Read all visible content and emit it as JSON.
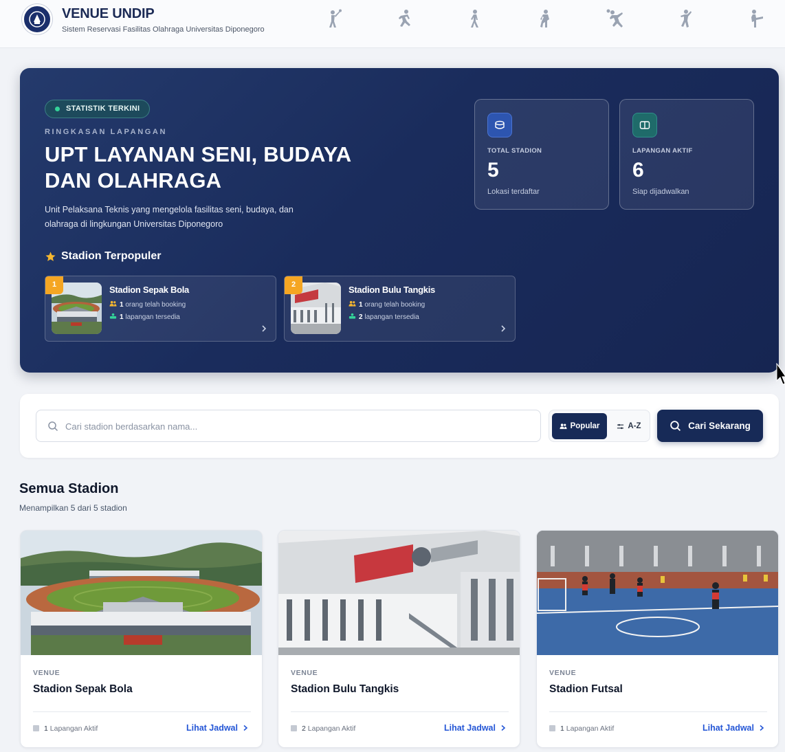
{
  "header": {
    "title": "VENUE UNDIP",
    "subtitle": "Sistem Reservasi Fasilitas Olahraga Universitas Diponegoro",
    "sport_icons": [
      "badminton-player-icon",
      "runner-icon",
      "walker-icon",
      "swimmer-icon",
      "basketball-player-icon",
      "dancer-icon",
      "kick-icon"
    ]
  },
  "hero": {
    "badge": "STATISTIK TERKINI",
    "kicker": "RINGKASAN LAPANGAN",
    "title": "UPT LAYANAN SENI, BUDAYA DAN OLAHRAGA",
    "description": "Unit Pelaksana Teknis yang mengelola fasilitas seni, budaya, dan olahraga di lingkungan Universitas Diponegoro",
    "popular_title": "Stadion Terpopuler",
    "popular": [
      {
        "rank": "1",
        "name": "Stadion Sepak Bola",
        "bookings_count": "1",
        "bookings_text": "orang telah booking",
        "courts_count": "1",
        "courts_text": "lapangan tersedia"
      },
      {
        "rank": "2",
        "name": "Stadion Bulu Tangkis",
        "bookings_count": "1",
        "bookings_text": "orang telah booking",
        "courts_count": "2",
        "courts_text": "lapangan tersedia"
      }
    ],
    "stats": [
      {
        "label": "TOTAL STADION",
        "value": "5",
        "sub": "Lokasi terdaftar",
        "icon": "database-icon"
      },
      {
        "label": "LAPANGAN AKTIF",
        "value": "6",
        "sub": "Siap dijadwalkan",
        "icon": "court-icon"
      }
    ]
  },
  "search": {
    "placeholder": "Cari stadion berdasarkan nama...",
    "value": "",
    "sort_popular": "Popular",
    "sort_az": "A-Z",
    "button": "Cari Sekarang"
  },
  "stadiums": {
    "title": "Semua Stadion",
    "subtitle": "Menampilkan 5 dari 5 stadion",
    "items": [
      {
        "kicker": "VENUE",
        "name": "Stadion Sepak Bola",
        "courts": "1",
        "courts_text": "Lapangan Aktif",
        "link": "Lihat Jadwal"
      },
      {
        "kicker": "VENUE",
        "name": "Stadion Bulu Tangkis",
        "courts": "2",
        "courts_text": "Lapangan Aktif",
        "link": "Lihat Jadwal"
      },
      {
        "kicker": "VENUE",
        "name": "Stadion Futsal",
        "courts": "1",
        "courts_text": "Lapangan Aktif",
        "link": "Lihat Jadwal"
      }
    ]
  },
  "colors": {
    "navy": "#172a57",
    "hero_gradient_start": "#243a6c",
    "accent_gold": "#f5a623",
    "link_blue": "#2456d6",
    "badge_green": "#34d399"
  }
}
